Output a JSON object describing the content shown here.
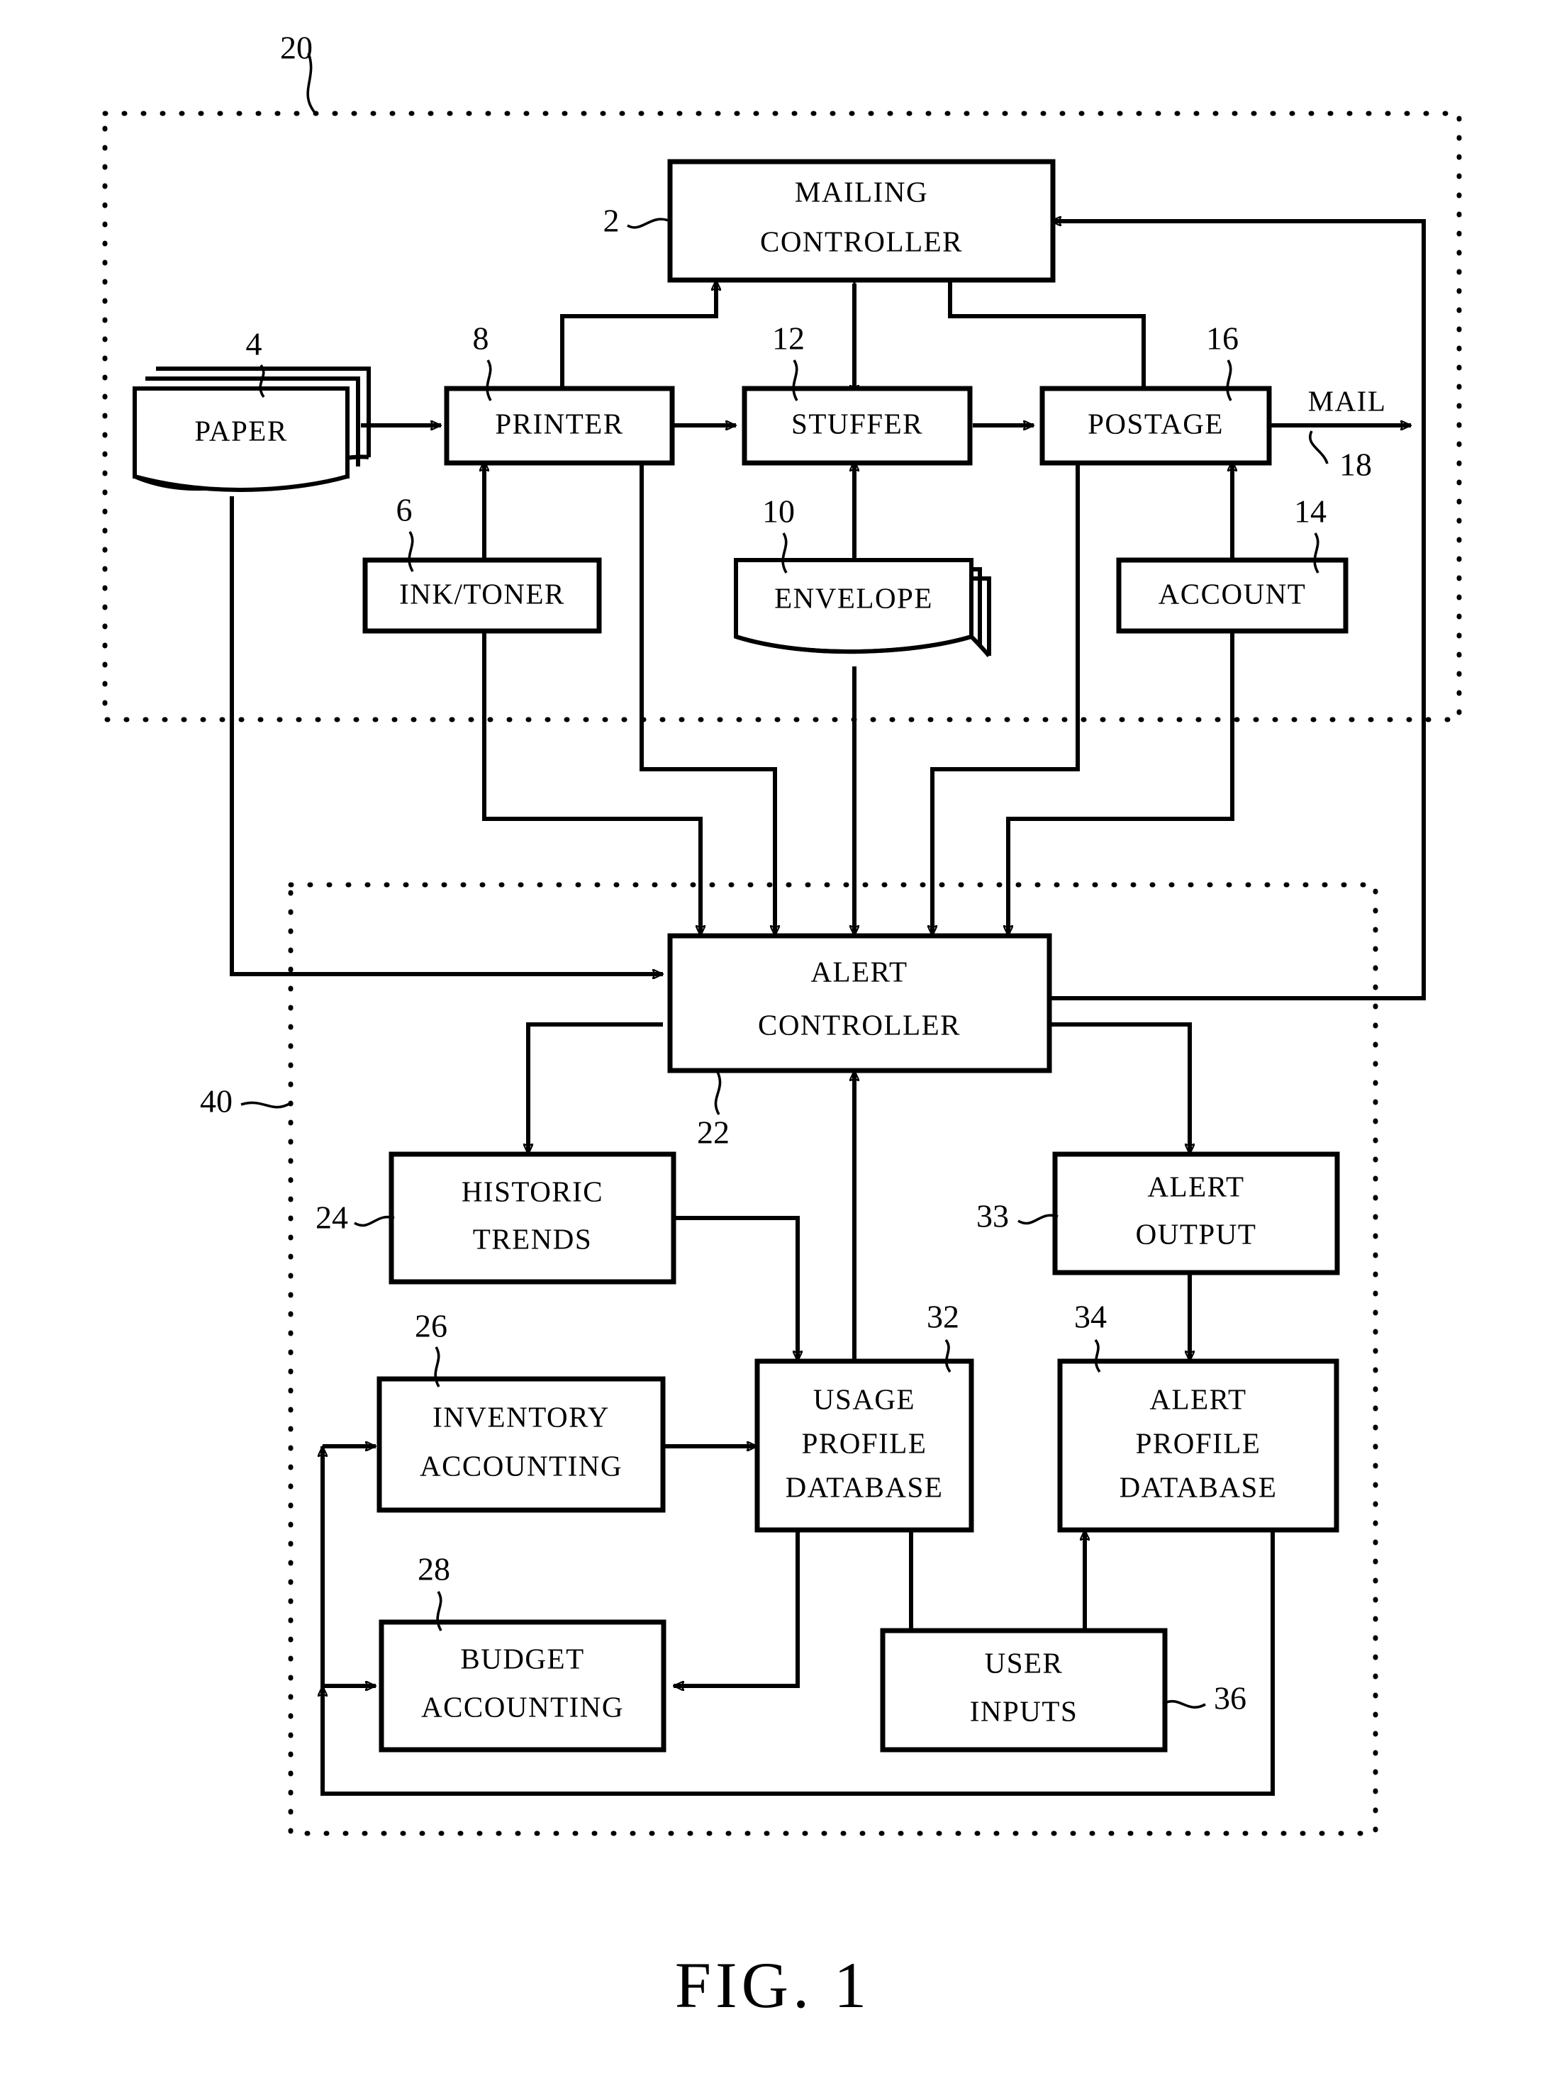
{
  "figure": {
    "caption": "FIG.  1",
    "title": "Mailing system with alert controller block diagram"
  },
  "regions": [
    {
      "id": "mailing-system",
      "ref": "20"
    },
    {
      "id": "alert-system",
      "ref": "40"
    }
  ],
  "blocks": [
    {
      "id": "mailing-controller",
      "ref": "2",
      "lines": [
        "MAILING",
        "CONTROLLER"
      ],
      "shape": "rect"
    },
    {
      "id": "paper",
      "ref": "4",
      "lines": [
        "PAPER"
      ],
      "shape": "stack"
    },
    {
      "id": "ink-toner",
      "ref": "6",
      "lines": [
        "INK/TONER"
      ],
      "shape": "rect"
    },
    {
      "id": "printer",
      "ref": "8",
      "lines": [
        "PRINTER"
      ],
      "shape": "rect"
    },
    {
      "id": "envelope",
      "ref": "10",
      "lines": [
        "ENVELOPE"
      ],
      "shape": "stack"
    },
    {
      "id": "stuffer",
      "ref": "12",
      "lines": [
        "STUFFER"
      ],
      "shape": "rect"
    },
    {
      "id": "account",
      "ref": "14",
      "lines": [
        "ACCOUNT"
      ],
      "shape": "rect"
    },
    {
      "id": "postage",
      "ref": "16",
      "lines": [
        "POSTAGE"
      ],
      "shape": "rect"
    },
    {
      "id": "alert-controller",
      "ref": "22",
      "lines": [
        "ALERT",
        "CONTROLLER"
      ],
      "shape": "rect"
    },
    {
      "id": "historic-trends",
      "ref": "24",
      "lines": [
        "HISTORIC",
        "TRENDS"
      ],
      "shape": "rect"
    },
    {
      "id": "inventory-accounting",
      "ref": "26",
      "lines": [
        "INVENTORY",
        "ACCOUNTING"
      ],
      "shape": "rect"
    },
    {
      "id": "budget-accounting",
      "ref": "28",
      "lines": [
        "BUDGET",
        "ACCOUNTING"
      ],
      "shape": "rect"
    },
    {
      "id": "usage-profile-database",
      "ref": "32",
      "lines": [
        "USAGE",
        "PROFILE",
        "DATABASE"
      ],
      "shape": "rect"
    },
    {
      "id": "alert-output",
      "ref": "33",
      "lines": [
        "ALERT",
        "OUTPUT"
      ],
      "shape": "rect"
    },
    {
      "id": "alert-profile-database",
      "ref": "34",
      "lines": [
        "ALERT",
        "PROFILE",
        "DATABASE"
      ],
      "shape": "rect"
    },
    {
      "id": "user-inputs",
      "ref": "36",
      "lines": [
        "USER",
        "INPUTS"
      ],
      "shape": "rect"
    }
  ],
  "flow_labels": [
    {
      "id": "mail-output",
      "text": "MAIL",
      "ref": "18"
    }
  ],
  "text": {
    "mailing_controller_l1": "MAILING",
    "mailing_controller_l2": "CONTROLLER",
    "paper": "PAPER",
    "ink_toner": "INK/TONER",
    "printer": "PRINTER",
    "envelope": "ENVELOPE",
    "stuffer": "STUFFER",
    "account": "ACCOUNT",
    "postage": "POSTAGE",
    "alert_controller_l1": "ALERT",
    "alert_controller_l2": "CONTROLLER",
    "historic_trends_l1": "HISTORIC",
    "historic_trends_l2": "TRENDS",
    "inventory_accounting_l1": "INVENTORY",
    "inventory_accounting_l2": "ACCOUNTING",
    "budget_accounting_l1": "BUDGET",
    "budget_accounting_l2": "ACCOUNTING",
    "usage_profile_db_l1": "USAGE",
    "usage_profile_db_l2": "PROFILE",
    "usage_profile_db_l3": "DATABASE",
    "alert_output_l1": "ALERT",
    "alert_output_l2": "OUTPUT",
    "alert_profile_db_l1": "ALERT",
    "alert_profile_db_l2": "PROFILE",
    "alert_profile_db_l3": "DATABASE",
    "user_inputs_l1": "USER",
    "user_inputs_l2": "INPUTS",
    "mail": "MAIL",
    "fig_caption": "FIG.  1"
  },
  "refs": {
    "r2": "2",
    "r4": "4",
    "r6": "6",
    "r8": "8",
    "r10": "10",
    "r12": "12",
    "r14": "14",
    "r16": "16",
    "r18": "18",
    "r20": "20",
    "r22": "22",
    "r24": "24",
    "r26": "26",
    "r28": "28",
    "r32": "32",
    "r33": "33",
    "r34": "34",
    "r36": "36",
    "r40": "40"
  },
  "colors": {
    "ink": "#000000",
    "paper_background": "#ffffff"
  }
}
